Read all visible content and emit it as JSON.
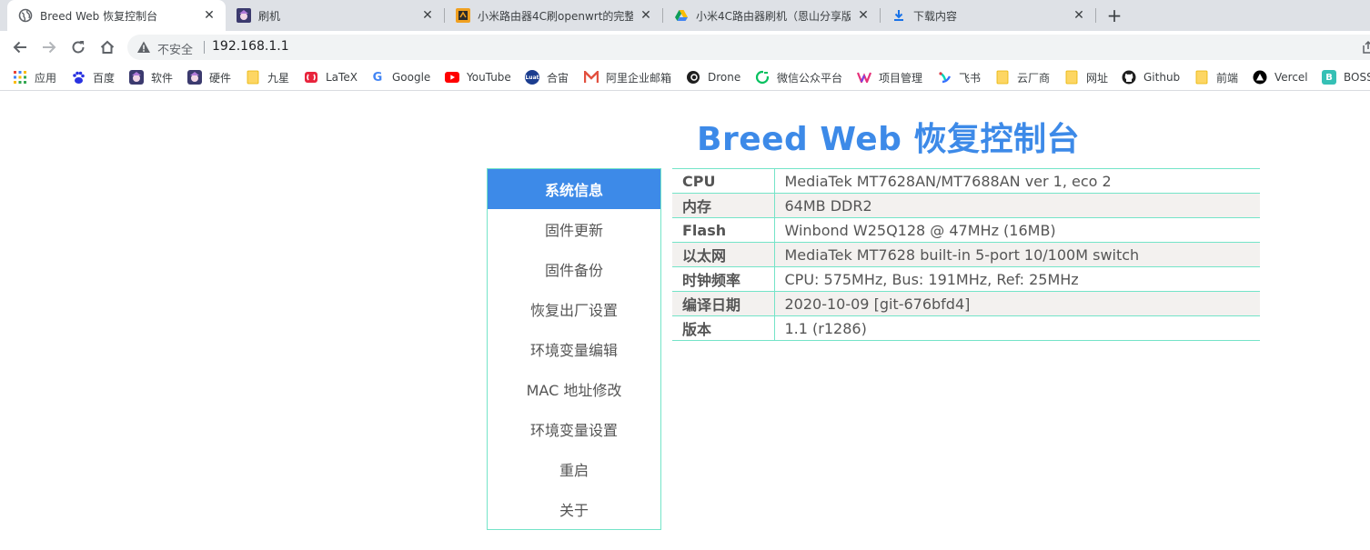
{
  "browser": {
    "tabs": [
      {
        "title": "Breed Web 恢复控制台",
        "favicon": "globe-icon",
        "active": true
      },
      {
        "title": "刷机",
        "favicon": "anime-avatar-icon",
        "active": false
      },
      {
        "title": "小米路由器4C刷openwrt的完整",
        "favicon": "blog-icon",
        "active": false
      },
      {
        "title": "小米4C路由器刷机（恩山分享版",
        "favicon": "google-drive-icon",
        "active": false
      },
      {
        "title": "下载内容",
        "favicon": "download-icon",
        "active": false
      }
    ],
    "new_tab": "+",
    "close_glyph": "✕",
    "address": {
      "security_label": "不安全",
      "url": "192.168.1.1"
    },
    "bookmarks": [
      {
        "label": "应用",
        "icon": "apps-grid-icon"
      },
      {
        "label": "百度",
        "icon": "baidu-icon"
      },
      {
        "label": "软件",
        "icon": "anime-avatar-icon"
      },
      {
        "label": "硬件",
        "icon": "anime-avatar-icon"
      },
      {
        "label": "九星",
        "icon": "folder-icon"
      },
      {
        "label": "LaTeX",
        "icon": "latex-icon"
      },
      {
        "label": "Google",
        "icon": "google-icon"
      },
      {
        "label": "YouTube",
        "icon": "youtube-icon"
      },
      {
        "label": "合宙",
        "icon": "luat-icon"
      },
      {
        "label": "阿里企业邮箱",
        "icon": "ali-mail-icon"
      },
      {
        "label": "Drone",
        "icon": "drone-icon"
      },
      {
        "label": "微信公众平台",
        "icon": "wechat-icon"
      },
      {
        "label": "项目管理",
        "icon": "project-icon"
      },
      {
        "label": "飞书",
        "icon": "feishu-icon"
      },
      {
        "label": "云厂商",
        "icon": "folder-icon"
      },
      {
        "label": "网址",
        "icon": "folder-icon"
      },
      {
        "label": "Github",
        "icon": "github-icon"
      },
      {
        "label": "前端",
        "icon": "folder-icon"
      },
      {
        "label": "Vercel",
        "icon": "vercel-icon"
      },
      {
        "label": "BOSS",
        "icon": "boss-icon"
      }
    ]
  },
  "page": {
    "title": "Breed Web 恢复控制台",
    "accent_color": "#3d8ae8",
    "border_color": "#74e4c8",
    "menu": [
      {
        "label": "系统信息",
        "active": true
      },
      {
        "label": "固件更新",
        "active": false
      },
      {
        "label": "固件备份",
        "active": false
      },
      {
        "label": "恢复出厂设置",
        "active": false
      },
      {
        "label": "环境变量编辑",
        "active": false
      },
      {
        "label": "MAC 地址修改",
        "active": false
      },
      {
        "label": "环境变量设置",
        "active": false
      },
      {
        "label": "重启",
        "active": false
      },
      {
        "label": "关于",
        "active": false
      }
    ],
    "system_info": [
      {
        "key": "CPU",
        "value": "MediaTek MT7628AN/MT7688AN ver 1, eco 2"
      },
      {
        "key": "内存",
        "value": "64MB DDR2"
      },
      {
        "key": "Flash",
        "value": "Winbond W25Q128 @ 47MHz (16MB)"
      },
      {
        "key": "以太网",
        "value": "MediaTek MT7628 built-in 5-port 10/100M switch"
      },
      {
        "key": "时钟频率",
        "value": "CPU: 575MHz, Bus: 191MHz, Ref: 25MHz"
      },
      {
        "key": "编译日期",
        "value": "2020-10-09 [git-676bfd4]"
      },
      {
        "key": "版本",
        "value": "1.1 (r1286)"
      }
    ]
  }
}
